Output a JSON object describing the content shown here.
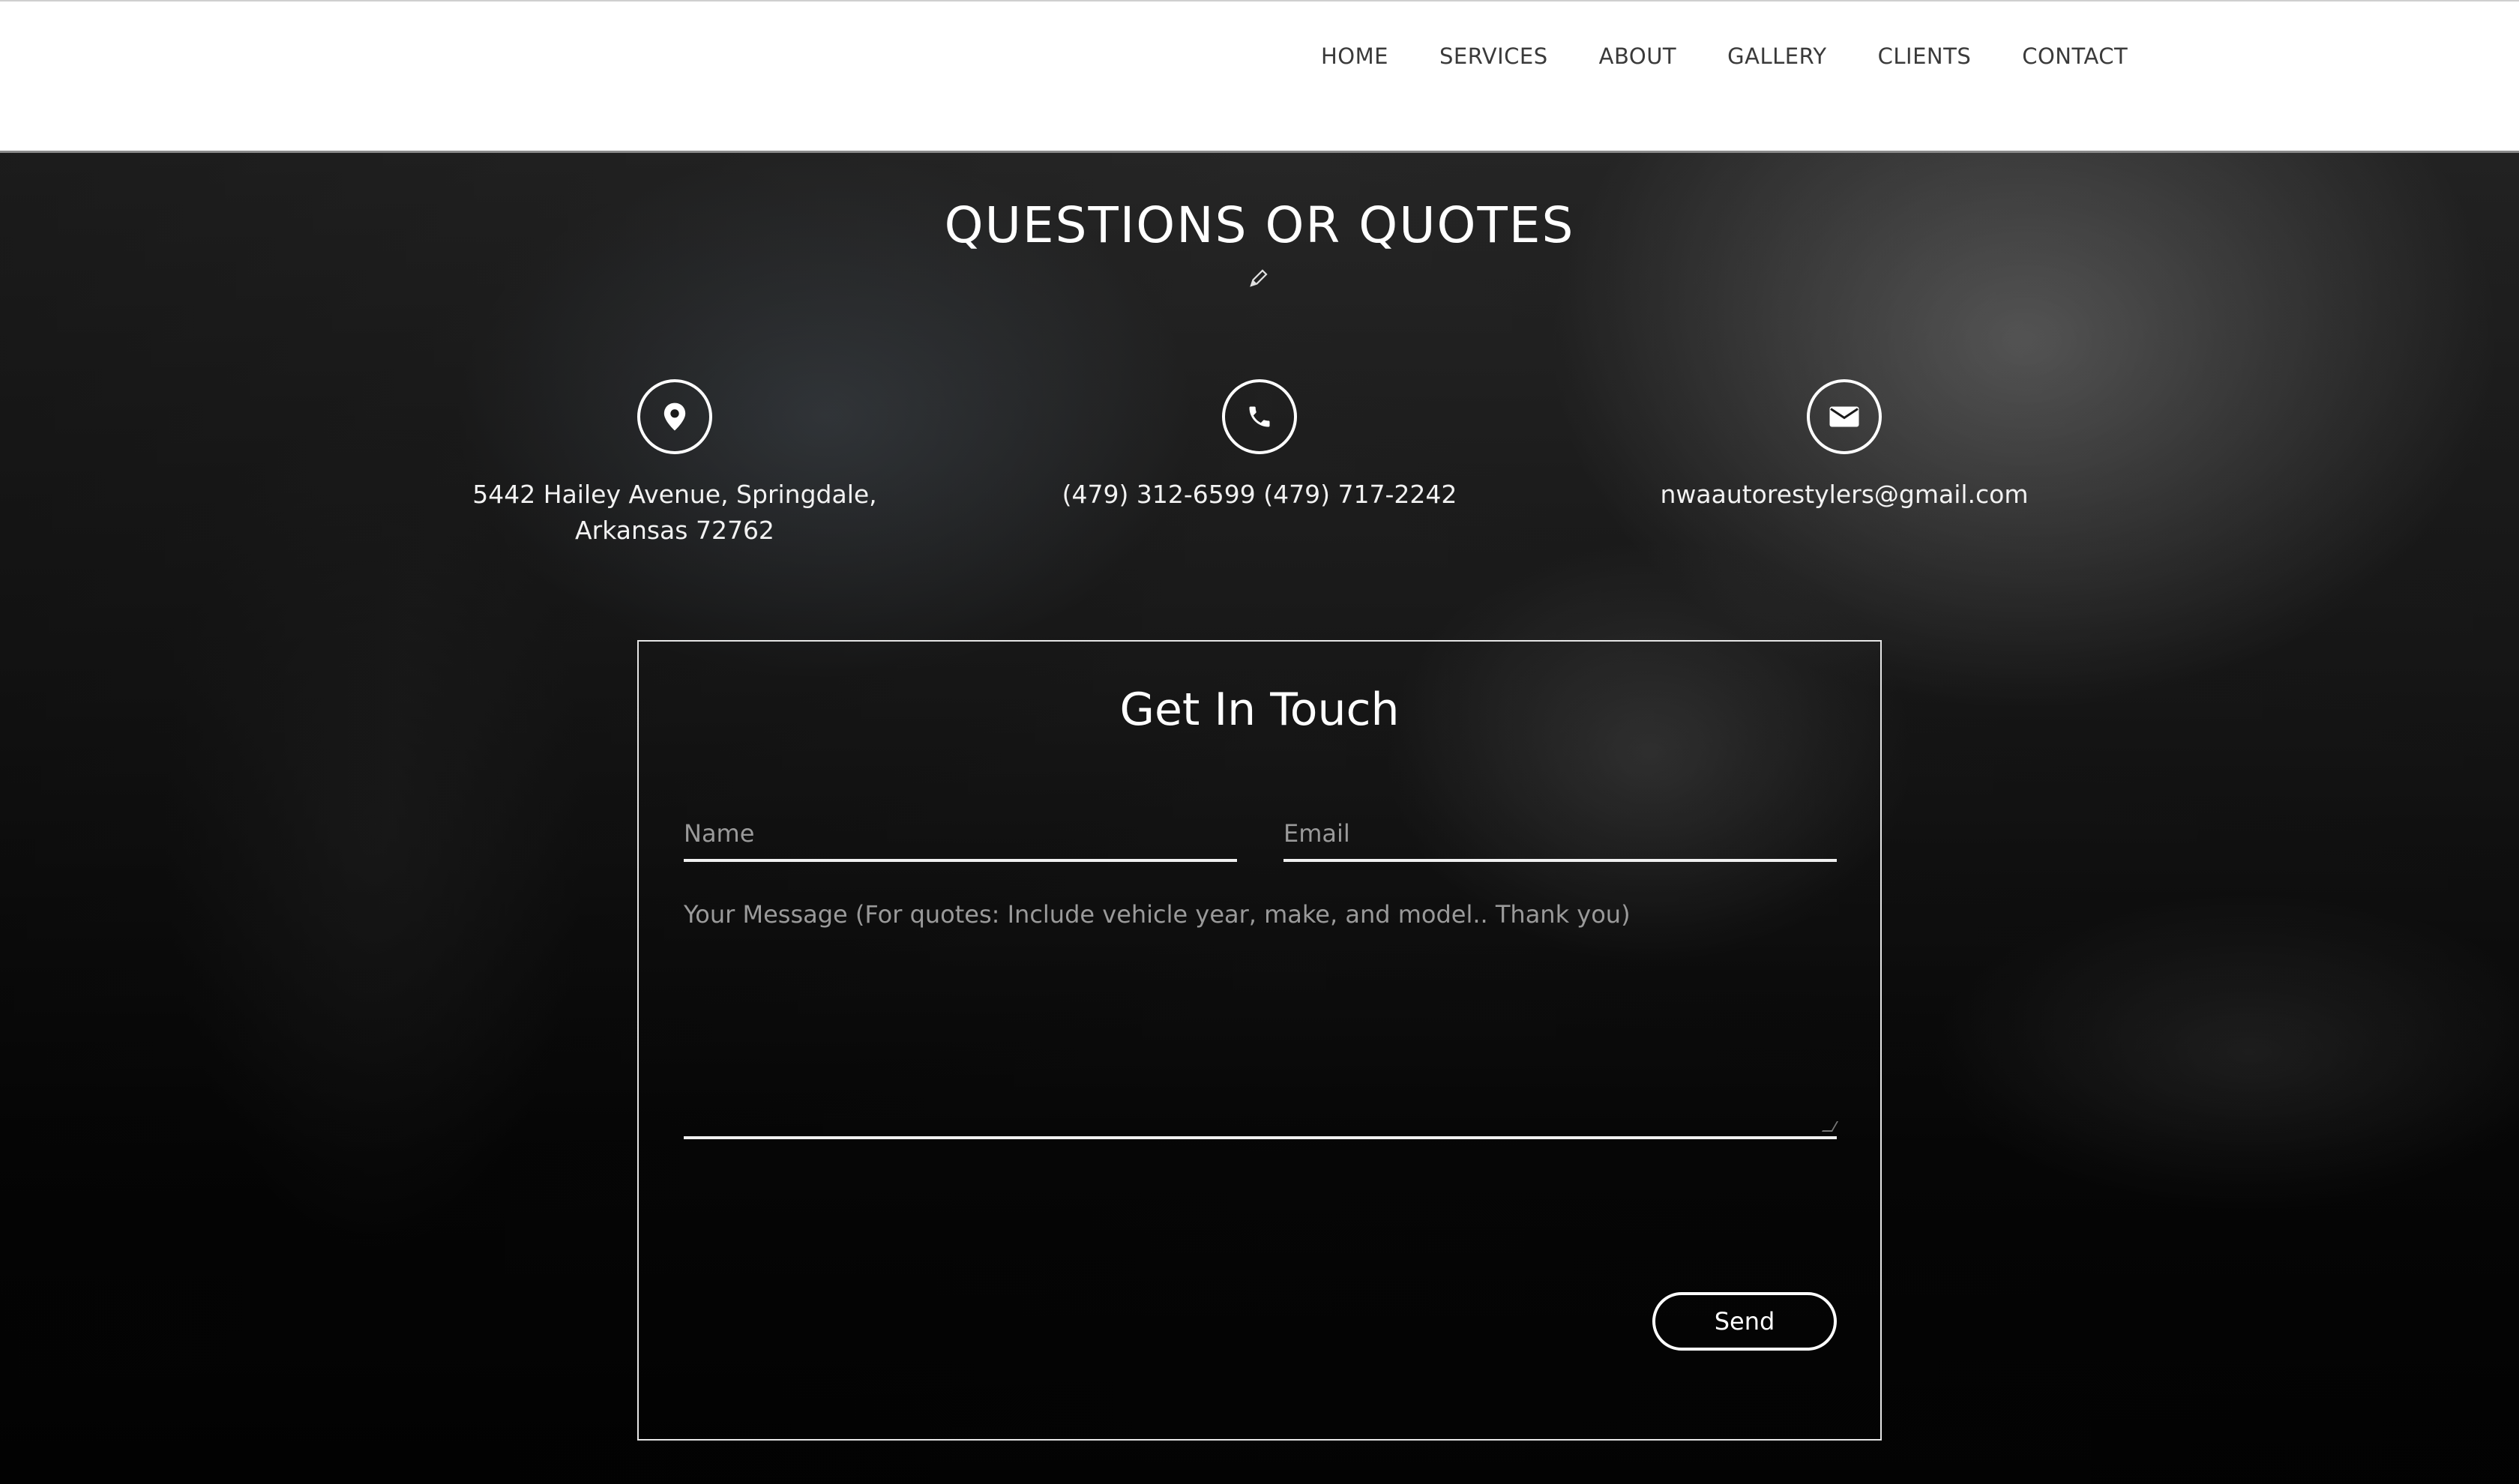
{
  "nav": {
    "items": [
      {
        "label": "HOME"
      },
      {
        "label": "SERVICES"
      },
      {
        "label": "ABOUT"
      },
      {
        "label": "GALLERY"
      },
      {
        "label": "CLIENTS"
      },
      {
        "label": "CONTACT"
      }
    ]
  },
  "section": {
    "title": "QUESTIONS OR QUOTES",
    "edit_icon": "pencil-icon"
  },
  "contact": {
    "address": {
      "icon": "map-pin-icon",
      "text": "5442 Hailey Avenue, Springdale, Arkansas 72762"
    },
    "phone": {
      "icon": "phone-icon",
      "text": "(479) 312-6599 (479) 717-2242"
    },
    "email": {
      "icon": "envelope-icon",
      "text": "nwaautorestylers@gmail.com"
    }
  },
  "form": {
    "title": "Get In Touch",
    "name_placeholder": "Name",
    "email_placeholder": "Email",
    "message_placeholder": "Your Message (For quotes: Include vehicle year, make, and model.. Thank you)",
    "send_label": "Send"
  },
  "colors": {
    "header_bg": "#ffffff",
    "nav_text": "#3a3a3a",
    "accent": "#ffffff"
  }
}
